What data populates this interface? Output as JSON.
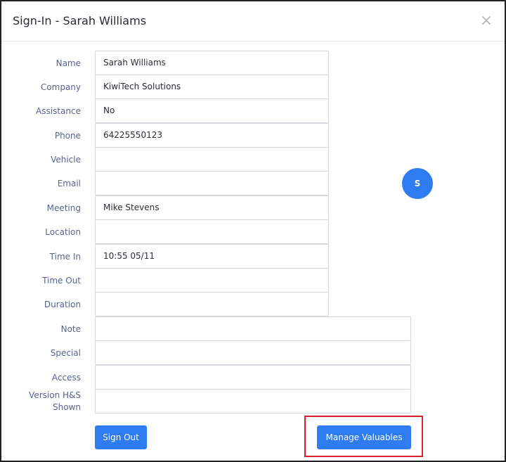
{
  "modal": {
    "title": "Sign-In - Sarah Williams",
    "close_symbol": "×",
    "close_icon": "close-icon"
  },
  "fields": [
    {
      "label": "Name",
      "value": "Sarah Williams"
    },
    {
      "label": "Company",
      "value": "KiwiTech Solutions"
    },
    {
      "label": "Assistance",
      "value": "No"
    },
    {
      "label": "Phone",
      "value": "64225550123"
    },
    {
      "label": "Vehicle",
      "value": ""
    },
    {
      "label": "Email",
      "value": ""
    },
    {
      "label": "Meeting",
      "value": "Mike Stevens"
    },
    {
      "label": "Location",
      "value": ""
    },
    {
      "label": "Time In",
      "value": "10:55 05/11"
    },
    {
      "label": "Time Out",
      "value": ""
    },
    {
      "label": "Duration",
      "value": ""
    },
    {
      "label": "Note",
      "value": ""
    },
    {
      "label": "Special",
      "value": ""
    },
    {
      "label": "Access",
      "value": ""
    },
    {
      "label": "Version H&S Shown",
      "value": ""
    }
  ],
  "avatar": {
    "initial": "S"
  },
  "buttons": {
    "sign_out": "Sign Out",
    "manage_valuables": "Manage Valuables"
  },
  "colors": {
    "accent": "#2f7cf0",
    "highlight": "#d6222a",
    "label_text": "#5a628e"
  }
}
